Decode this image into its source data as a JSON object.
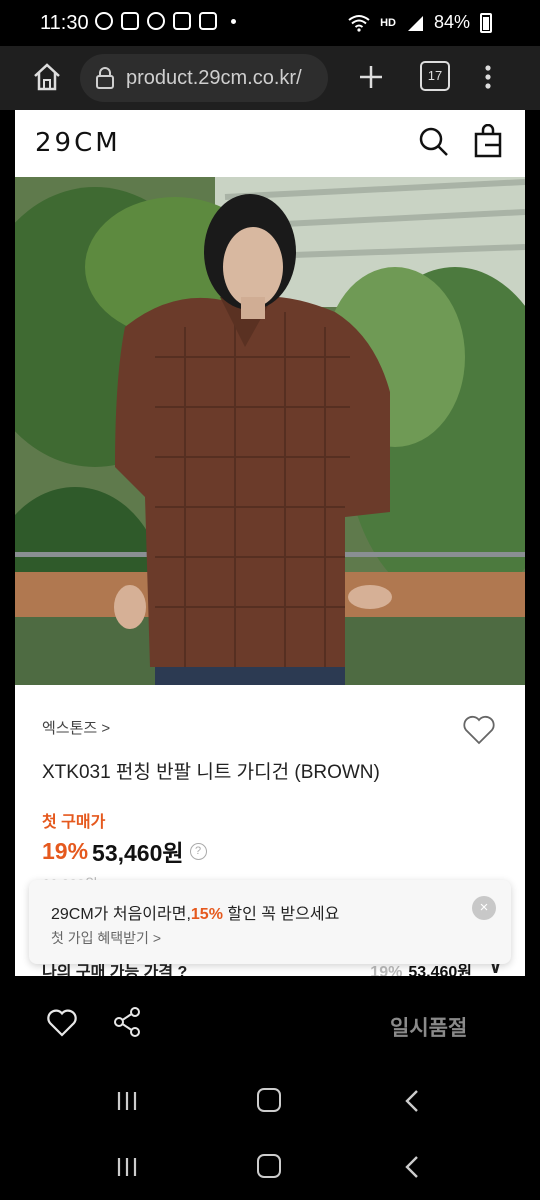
{
  "status_bar": {
    "time": "11:30",
    "battery": "84%",
    "network": "HD",
    "icons": [
      "talk-icon",
      "gallery-icon",
      "chat-icon",
      "instagram-icon",
      "instagram-icon",
      "wifi-icon",
      "signal-icon",
      "battery-icon"
    ]
  },
  "browser": {
    "url": "product.29cm.co.kr/",
    "tab_count": "17"
  },
  "site": {
    "logo": "29CM"
  },
  "product": {
    "brand_link": "엑스톤즈 >",
    "name": "XTK031 펀칭 반팔 니트 가디건 (BROWN)",
    "first_buy_label": "첫 구매가",
    "discount": "19%",
    "price": "53,460원",
    "help_icon_text": "?",
    "original_price": "66,000원"
  },
  "toast": {
    "main_before": "29CM가 처음이라면,",
    "main_accent": "15%",
    "main_after": " 할인 꼭 받으세요",
    "sub": "첫 가입 혜택받기 >",
    "close_symbol": "×"
  },
  "my_price_row": {
    "label": "나의 구매 가능 가격 ?",
    "discount": "19%",
    "price": "53,460원",
    "chevron": "∨"
  },
  "action_bar": {
    "soldout_label": "일시품절"
  },
  "colors": {
    "accent": "#e5591e",
    "page_bg": "#ffffff",
    "system_bg": "#000000"
  }
}
